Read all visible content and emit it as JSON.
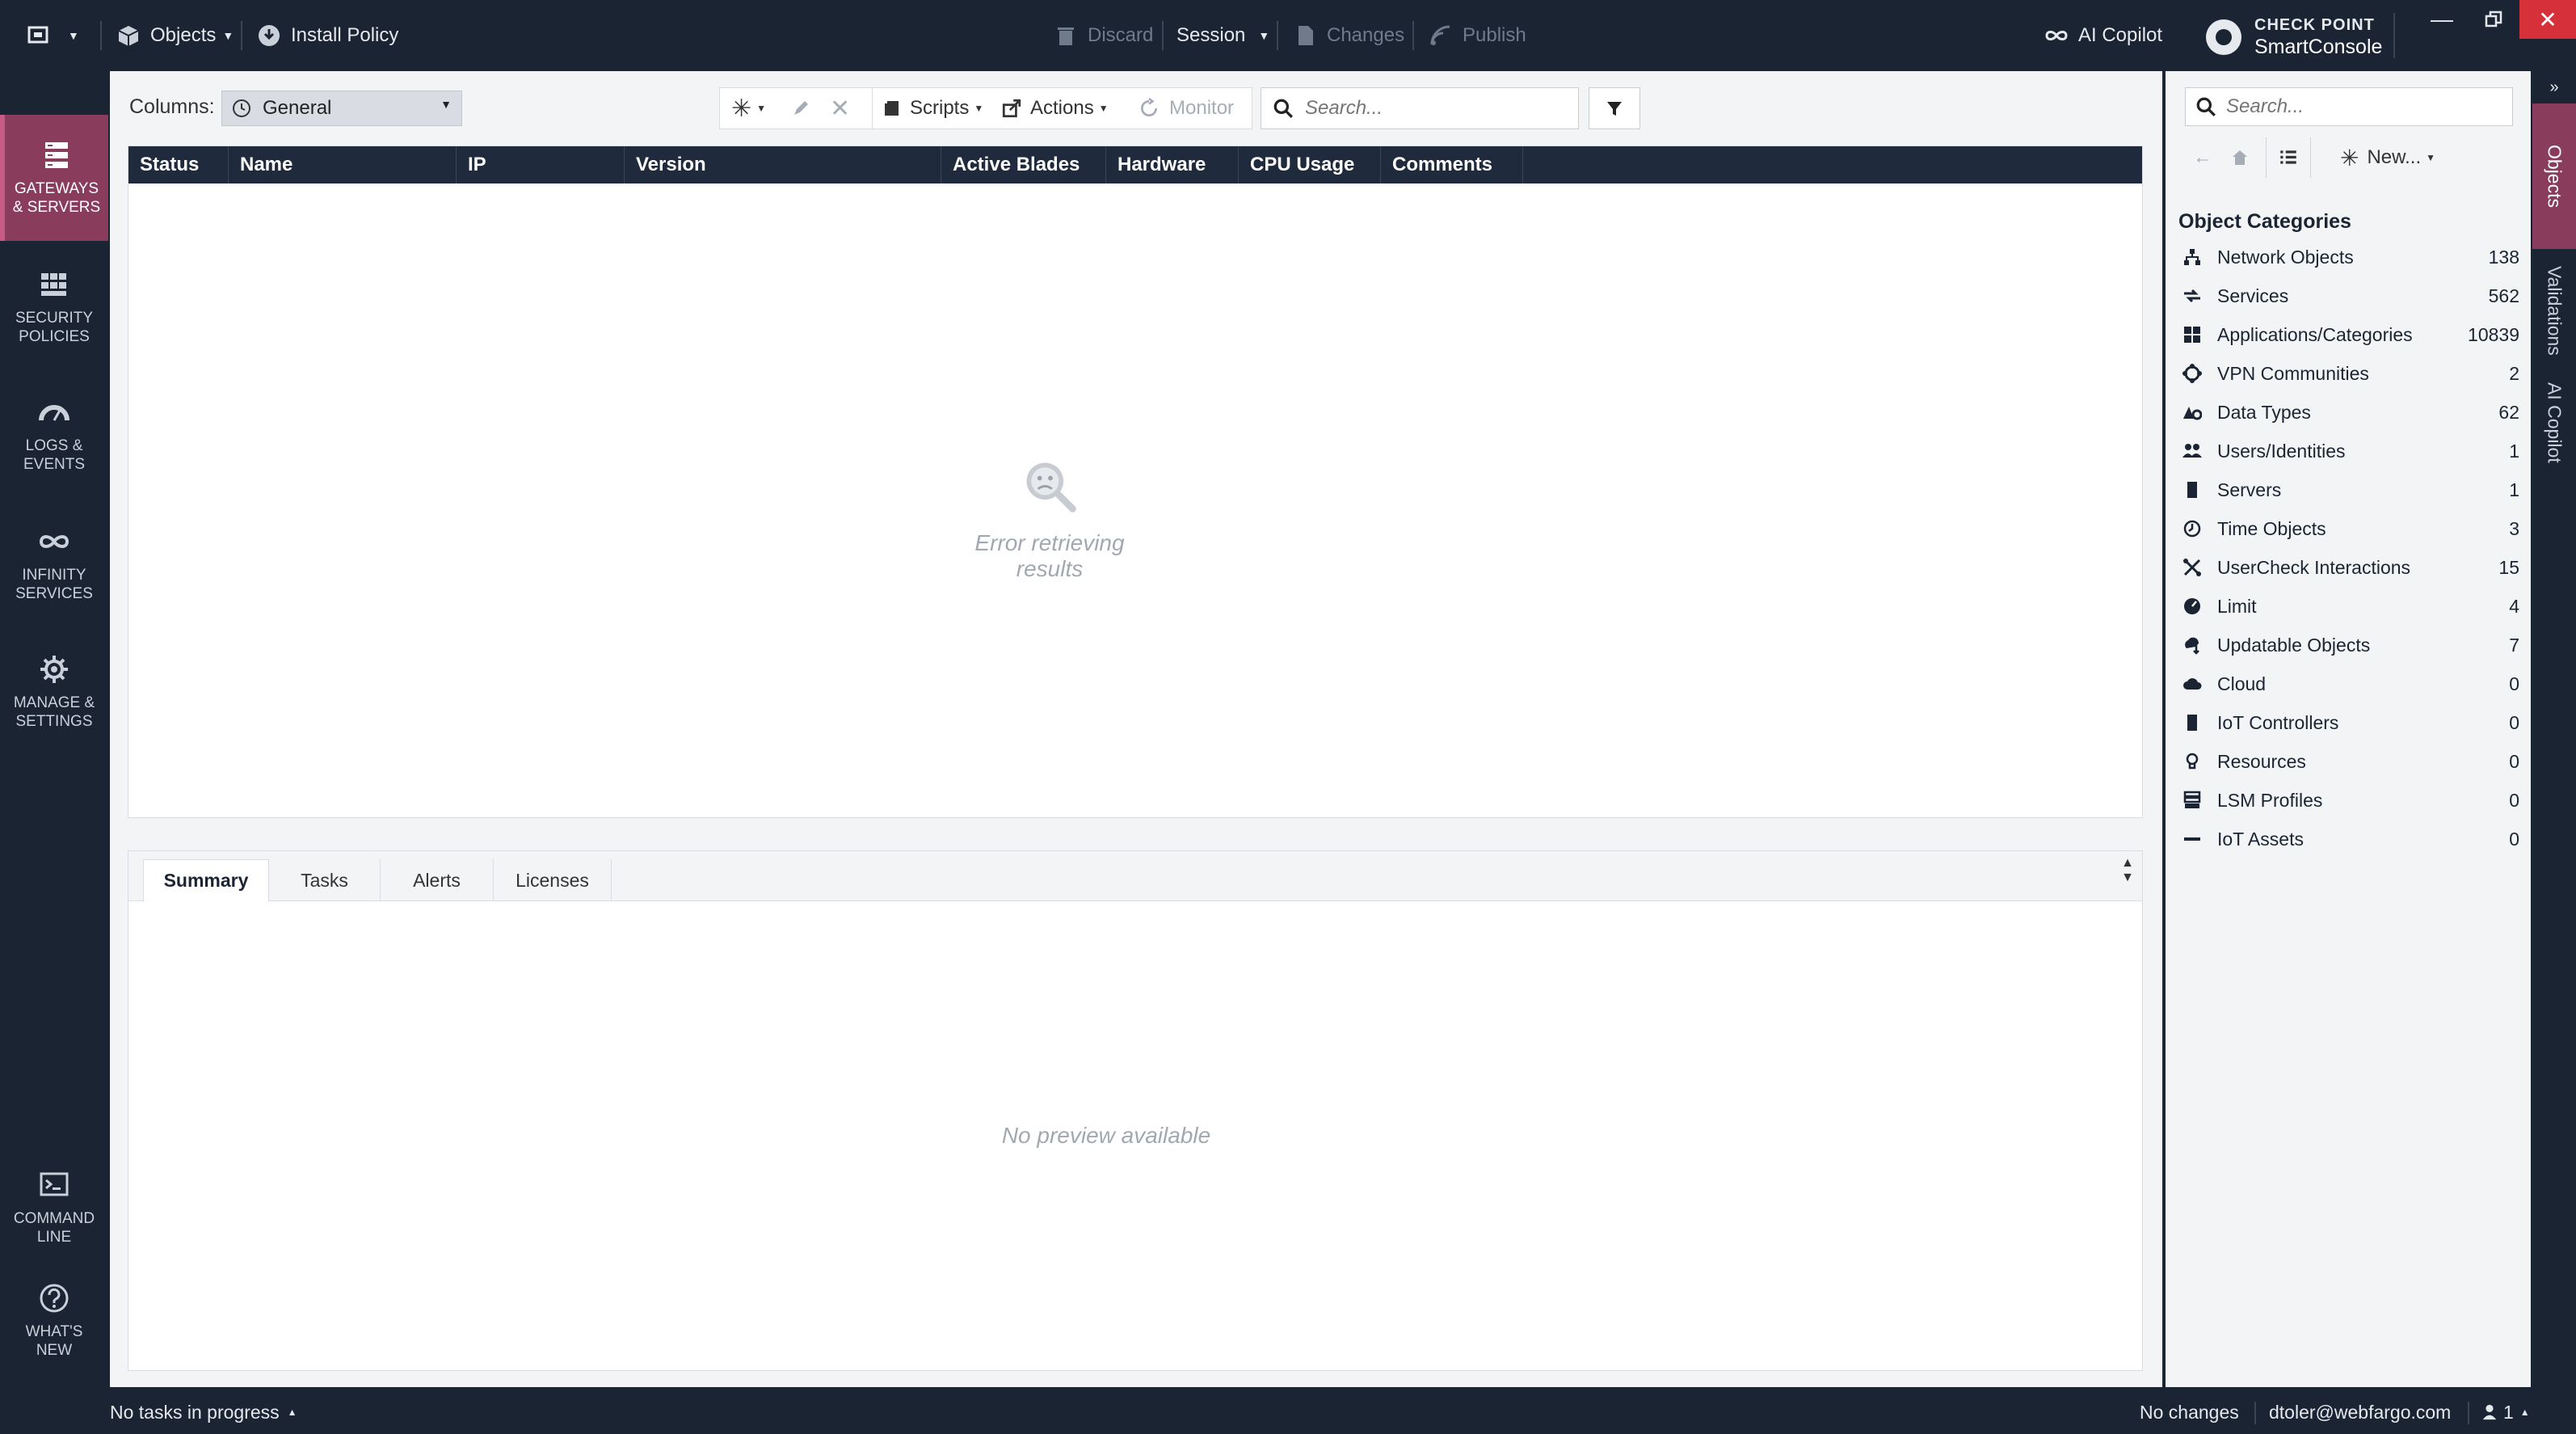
{
  "topbar": {
    "objects_label": "Objects",
    "install_policy_label": "Install Policy",
    "discard_label": "Discard",
    "session_label": "Session",
    "changes_label": "Changes",
    "publish_label": "Publish",
    "ai_copilot_label": "AI Copilot",
    "brand_line1": "CHECK POINT",
    "brand_line2": "SmartConsole"
  },
  "leftnav": {
    "items": [
      {
        "label": "GATEWAYS & SERVERS",
        "active": true
      },
      {
        "label": "SECURITY POLICIES"
      },
      {
        "label": "LOGS & EVENTS"
      },
      {
        "label": "INFINITY SERVICES"
      },
      {
        "label": "MANAGE & SETTINGS"
      }
    ],
    "bottom_items": [
      {
        "label": "COMMAND LINE"
      },
      {
        "label": "WHAT'S NEW"
      }
    ]
  },
  "toolbar": {
    "columns_label": "Columns:",
    "columns_value": "General",
    "scripts_label": "Scripts",
    "actions_label": "Actions",
    "monitor_label": "Monitor",
    "search_placeholder": "Search..."
  },
  "grid": {
    "columns": [
      "Status",
      "Name",
      "IP",
      "Version",
      "Active Blades",
      "Hardware",
      "CPU Usage",
      "Comments"
    ],
    "empty_message": "Error retrieving results"
  },
  "lower": {
    "tabs": [
      "Summary",
      "Tasks",
      "Alerts",
      "Licenses"
    ],
    "active_tab": "Summary",
    "empty_message": "No preview available"
  },
  "objects_panel": {
    "search_placeholder": "Search...",
    "new_label": "New...",
    "categories_title": "Object Categories",
    "categories": [
      {
        "name": "Network Objects",
        "count": "138",
        "icon": "network-icon"
      },
      {
        "name": "Services",
        "count": "562",
        "icon": "services-icon"
      },
      {
        "name": "Applications/Categories",
        "count": "10839",
        "icon": "applications-icon"
      },
      {
        "name": "VPN Communities",
        "count": "2",
        "icon": "vpn-icon"
      },
      {
        "name": "Data Types",
        "count": "62",
        "icon": "data-types-icon"
      },
      {
        "name": "Users/Identities",
        "count": "1",
        "icon": "users-icon"
      },
      {
        "name": "Servers",
        "count": "1",
        "icon": "server-icon"
      },
      {
        "name": "Time Objects",
        "count": "3",
        "icon": "clock-icon"
      },
      {
        "name": "UserCheck Interactions",
        "count": "15",
        "icon": "usercheck-icon"
      },
      {
        "name": "Limit",
        "count": "4",
        "icon": "limit-icon"
      },
      {
        "name": "Updatable Objects",
        "count": "7",
        "icon": "updatable-icon"
      },
      {
        "name": "Cloud",
        "count": "0",
        "icon": "cloud-icon"
      },
      {
        "name": "IoT Controllers",
        "count": "0",
        "icon": "iot-controller-icon"
      },
      {
        "name": "Resources",
        "count": "0",
        "icon": "resources-icon"
      },
      {
        "name": "LSM Profiles",
        "count": "0",
        "icon": "lsm-icon"
      },
      {
        "name": "IoT Assets",
        "count": "0",
        "icon": "iot-assets-icon"
      }
    ]
  },
  "sidetabs": [
    "Objects",
    "Validations",
    "AI Copilot"
  ],
  "statusbar": {
    "tasks_label": "No tasks in progress",
    "changes_label": "No changes",
    "user_label": "dtoler@webfargo.com",
    "sessions_count": "1"
  },
  "colors": {
    "chrome": "#1b2433",
    "accent": "#8a3c5c",
    "grid_header": "#1f2a3c",
    "close": "#d6303a"
  }
}
